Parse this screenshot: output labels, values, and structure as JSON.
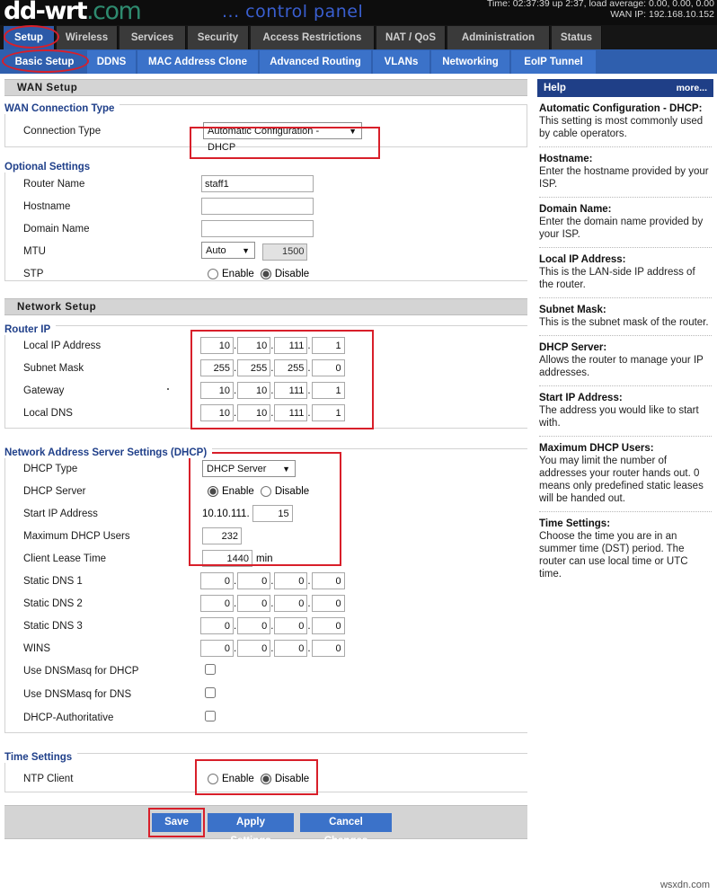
{
  "banner": {
    "logo_main": "dd-wrt",
    "logo_com": ".com",
    "control_panel": "... control panel",
    "status_line1": "Time: 02:37:39 up 2:37, load average: 0.00, 0.00, 0.00",
    "status_line2": "WAN IP: 192.168.10.152"
  },
  "nav": {
    "tabs": [
      {
        "label": "Setup",
        "active": true
      },
      {
        "label": "Wireless",
        "active": false
      },
      {
        "label": "Services",
        "active": false
      },
      {
        "label": "Security",
        "active": false
      },
      {
        "label": "Access Restrictions",
        "active": false
      },
      {
        "label": "NAT / QoS",
        "active": false
      },
      {
        "label": "Administration",
        "active": false
      },
      {
        "label": "Status",
        "active": false
      }
    ],
    "subtabs": [
      {
        "label": "Basic Setup",
        "active": true
      },
      {
        "label": "DDNS",
        "active": false
      },
      {
        "label": "MAC Address Clone",
        "active": false
      },
      {
        "label": "Advanced Routing",
        "active": false
      },
      {
        "label": "VLANs",
        "active": false
      },
      {
        "label": "Networking",
        "active": false
      },
      {
        "label": "EoIP Tunnel",
        "active": false
      }
    ]
  },
  "wan_setup": {
    "section_title": "WAN Setup",
    "group_title": "WAN Connection Type",
    "connection_type_label": "Connection Type",
    "connection_type_value": "Automatic Configuration - DHCP"
  },
  "optional": {
    "group_title": "Optional Settings",
    "router_name_label": "Router Name",
    "router_name_value": "staff1",
    "hostname_label": "Hostname",
    "hostname_value": "",
    "domain_name_label": "Domain Name",
    "domain_name_value": "",
    "mtu_label": "MTU",
    "mtu_mode": "Auto",
    "mtu_value": "1500",
    "stp_label": "STP",
    "enable_label": "Enable",
    "disable_label": "Disable",
    "stp_selected": "Disable"
  },
  "network_setup": {
    "section_title": "Network Setup",
    "group_title": "Router IP",
    "rows": [
      {
        "label": "Local IP Address",
        "octets": [
          "10",
          "10",
          "111",
          "1"
        ]
      },
      {
        "label": "Subnet Mask",
        "octets": [
          "255",
          "255",
          "255",
          "0"
        ]
      },
      {
        "label": "Gateway",
        "octets": [
          "10",
          "10",
          "111",
          "1"
        ]
      },
      {
        "label": "Local DNS",
        "octets": [
          "10",
          "10",
          "111",
          "1"
        ]
      }
    ]
  },
  "dhcp": {
    "group_title": "Network Address Server Settings (DHCP)",
    "dhcp_type_label": "DHCP Type",
    "dhcp_type_value": "DHCP Server",
    "dhcp_server_label": "DHCP Server",
    "enable_label": "Enable",
    "disable_label": "Disable",
    "dhcp_server_selected": "Enable",
    "start_ip_label": "Start IP Address",
    "start_ip_prefix": "10.10.111.",
    "start_ip_value": "15",
    "max_users_label": "Maximum DHCP Users",
    "max_users_value": "232",
    "lease_time_label": "Client Lease Time",
    "lease_time_value": "1440",
    "lease_time_unit": "min",
    "ip_rows": [
      {
        "label": "Static DNS 1",
        "octets": [
          "0",
          "0",
          "0",
          "0"
        ]
      },
      {
        "label": "Static DNS 2",
        "octets": [
          "0",
          "0",
          "0",
          "0"
        ]
      },
      {
        "label": "Static DNS 3",
        "octets": [
          "0",
          "0",
          "0",
          "0"
        ]
      },
      {
        "label": "WINS",
        "octets": [
          "0",
          "0",
          "0",
          "0"
        ]
      }
    ],
    "checkboxes": [
      {
        "label": "Use DNSMasq for DHCP",
        "checked": false
      },
      {
        "label": "Use DNSMasq for DNS",
        "checked": false
      },
      {
        "label": "DHCP-Authoritative",
        "checked": false
      }
    ]
  },
  "time_settings": {
    "group_title": "Time Settings",
    "ntp_label": "NTP Client",
    "enable_label": "Enable",
    "disable_label": "Disable",
    "ntp_selected": "Disable"
  },
  "buttons": {
    "save": "Save",
    "apply": "Apply Settings",
    "cancel": "Cancel Changes"
  },
  "help": {
    "title": "Help",
    "more": "more...",
    "items": [
      {
        "title": "Automatic Configuration - DHCP:",
        "desc": "This setting is most commonly used by cable operators."
      },
      {
        "title": "Hostname:",
        "desc": "Enter the hostname provided by your ISP."
      },
      {
        "title": "Domain Name:",
        "desc": "Enter the domain name provided by your ISP."
      },
      {
        "title": "Local IP Address:",
        "desc": "This is the LAN-side IP address of the router."
      },
      {
        "title": "Subnet Mask:",
        "desc": "This is the subnet mask of the router."
      },
      {
        "title": "DHCP Server:",
        "desc": "Allows the router to manage your IP addresses."
      },
      {
        "title": "Start IP Address:",
        "desc": "The address you would like to start with."
      },
      {
        "title": "Maximum DHCP Users:",
        "desc": "You may limit the number of addresses your router hands out. 0 means only predefined static leases will be handed out."
      },
      {
        "title": "Time Settings:",
        "desc": "Choose the time you are in an summer time (DST) period. The router can use local time or UTC time."
      }
    ]
  },
  "watermark": "wsxdn.com",
  "colors": {
    "accent_blue": "#3b72c9",
    "nav_blue": "#2f5fae",
    "help_header": "#1f3f87",
    "annotation_red": "#d81f2a",
    "legend_blue": "#20408a"
  }
}
